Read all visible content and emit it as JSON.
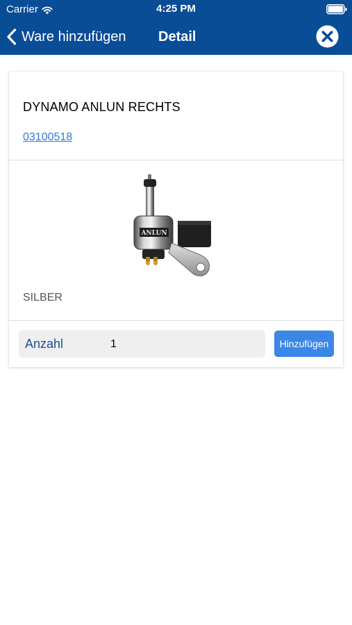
{
  "status_bar": {
    "carrier": "Carrier",
    "time": "4:25 PM"
  },
  "nav": {
    "back_label": "Ware hinzufügen",
    "title": "Detail",
    "back_icon": "chevron-left-icon",
    "close_icon": "close-icon"
  },
  "product": {
    "name": "DYNAMO ANLUN RECHTS",
    "article_number": "03100518",
    "image_brand_text": "ANLUN",
    "color": "SILBER"
  },
  "quantity": {
    "label": "Anzahl",
    "value": "1"
  },
  "add_button": {
    "label": "Hinzufügen"
  },
  "colors": {
    "header_bg": "#0a4d97",
    "link": "#3478d4",
    "button_bg": "#3b87e8",
    "quantity_label": "#1a4f8f"
  }
}
